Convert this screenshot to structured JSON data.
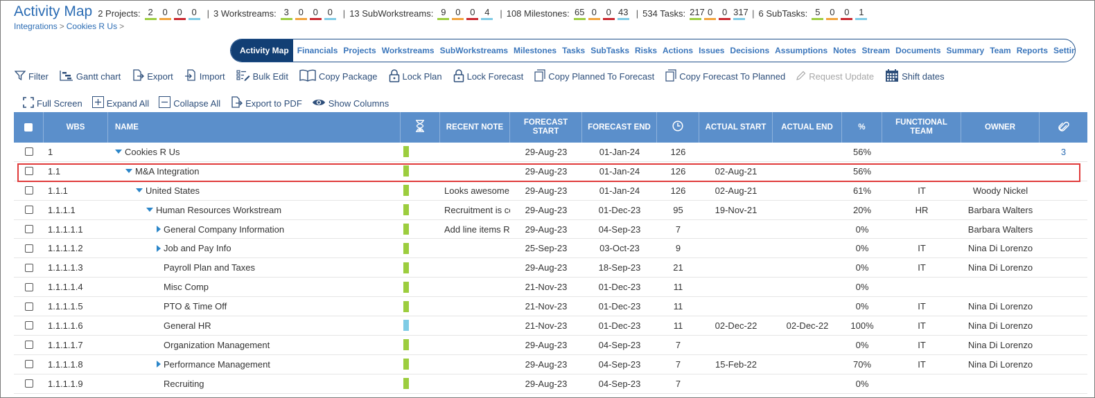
{
  "header": {
    "title": "Activity Map",
    "stats": [
      {
        "label": "2 Projects:",
        "values": [
          "2",
          "0",
          "0",
          "0"
        ]
      },
      {
        "label": "3 Workstreams:",
        "values": [
          "3",
          "0",
          "0",
          "0"
        ]
      },
      {
        "label": "13 SubWorkstreams:",
        "values": [
          "9",
          "0",
          "0",
          "4"
        ]
      },
      {
        "label": "108 Milestones:",
        "values": [
          "65",
          "0",
          "0",
          "43"
        ]
      },
      {
        "label": "534 Tasks:",
        "values": [
          "217",
          "0",
          "0",
          "317"
        ]
      },
      {
        "label": "6 SubTasks:",
        "values": [
          "5",
          "0",
          "0",
          "1"
        ]
      }
    ],
    "stat_separator": "|",
    "status_colors": [
      "#9ccd3e",
      "#f2a33a",
      "#c9252c",
      "#7ecbe5"
    ]
  },
  "breadcrumb": {
    "items": [
      "Integrations",
      "Cookies R Us"
    ],
    "separator": ">"
  },
  "nav": {
    "items": [
      "Activity Map",
      "Financials",
      "Projects",
      "Workstreams",
      "SubWorkstreams",
      "Milestones",
      "Tasks",
      "SubTasks",
      "Risks",
      "Actions",
      "Issues",
      "Decisions",
      "Assumptions",
      "Notes",
      "Stream",
      "Documents",
      "Summary",
      "Team",
      "Reports",
      "Settings"
    ],
    "active": "Activity Map"
  },
  "toolbar": {
    "filter": "Filter",
    "gantt": "Gantt chart",
    "export": "Export",
    "import": "Import",
    "bulk_edit": "Bulk Edit",
    "copy_package": "Copy Package",
    "lock_plan": "Lock Plan",
    "lock_forecast": "Lock Forecast",
    "copy_planned_to_forecast": "Copy Planned To Forecast",
    "copy_forecast_to_planned": "Copy Forecast To Planned",
    "request_update": "Request Update",
    "shift_dates": "Shift dates"
  },
  "toolbar2": {
    "full_screen": "Full Screen",
    "expand_all": "Expand All",
    "collapse_all": "Collapse All",
    "export_pdf": "Export to PDF",
    "show_columns": "Show Columns"
  },
  "table": {
    "columns": {
      "wbs": "WBS",
      "name": "NAME",
      "recent_note": "RECENT NOTE",
      "forecast_start": "FORECAST START",
      "forecast_end": "FORECAST END",
      "actual_start": "ACTUAL START",
      "actual_end": "ACTUAL END",
      "pct": "%",
      "functional_team": "FUNCTIONAL TEAM",
      "owner": "OWNER"
    },
    "rows": [
      {
        "wbs": "1",
        "name": "Cookies R Us",
        "indent": 0,
        "toggle": "down",
        "status": "#9ccd3e",
        "note": "",
        "fs": "29-Aug-23",
        "fe": "01-Jan-24",
        "dur": "126",
        "as": "",
        "ae": "",
        "pct": "56%",
        "team": "",
        "owner": "",
        "attach": "3"
      },
      {
        "wbs": "1.1",
        "name": "M&A Integration",
        "indent": 1,
        "toggle": "down",
        "status": "#9ccd3e",
        "note": "",
        "fs": "29-Aug-23",
        "fe": "01-Jan-24",
        "dur": "126",
        "as": "02-Aug-21",
        "ae": "",
        "pct": "56%",
        "team": "",
        "owner": "",
        "attach": ""
      },
      {
        "wbs": "1.1.1",
        "name": "United States",
        "indent": 2,
        "toggle": "down",
        "status": "#9ccd3e",
        "note": "Looks awesome",
        "fs": "29-Aug-23",
        "fe": "01-Jan-24",
        "dur": "126",
        "as": "02-Aug-21",
        "ae": "",
        "pct": "61%",
        "team": "IT",
        "owner": "Woody Nickel",
        "attach": ""
      },
      {
        "wbs": "1.1.1.1",
        "name": "Human Resources Workstream",
        "indent": 3,
        "toggle": "down",
        "status": "#9ccd3e",
        "note": "Recruitment is co",
        "fs": "29-Aug-23",
        "fe": "01-Dec-23",
        "dur": "95",
        "as": "19-Nov-21",
        "ae": "",
        "pct": "20%",
        "team": "HR",
        "owner": "Barbara Walters",
        "attach": ""
      },
      {
        "wbs": "1.1.1.1.1",
        "name": "General Company Information",
        "indent": 4,
        "toggle": "right",
        "status": "#9ccd3e",
        "note": "Add line items R",
        "fs": "29-Aug-23",
        "fe": "04-Sep-23",
        "dur": "7",
        "as": "",
        "ae": "",
        "pct": "0%",
        "team": "",
        "owner": "Barbara Walters",
        "attach": ""
      },
      {
        "wbs": "1.1.1.1.2",
        "name": "Job and Pay Info",
        "indent": 4,
        "toggle": "right",
        "status": "#9ccd3e",
        "note": "",
        "fs": "25-Sep-23",
        "fe": "03-Oct-23",
        "dur": "9",
        "as": "",
        "ae": "",
        "pct": "0%",
        "team": "IT",
        "owner": "Nina Di Lorenzo",
        "attach": ""
      },
      {
        "wbs": "1.1.1.1.3",
        "name": "Payroll Plan and Taxes",
        "indent": 4,
        "toggle": "none",
        "status": "#9ccd3e",
        "note": "",
        "fs": "29-Aug-23",
        "fe": "18-Sep-23",
        "dur": "21",
        "as": "",
        "ae": "",
        "pct": "0%",
        "team": "IT",
        "owner": "Nina Di Lorenzo",
        "attach": ""
      },
      {
        "wbs": "1.1.1.1.4",
        "name": "Misc Comp",
        "indent": 4,
        "toggle": "none",
        "status": "#9ccd3e",
        "note": "",
        "fs": "21-Nov-23",
        "fe": "01-Dec-23",
        "dur": "11",
        "as": "",
        "ae": "",
        "pct": "0%",
        "team": "",
        "owner": "",
        "attach": ""
      },
      {
        "wbs": "1.1.1.1.5",
        "name": "PTO & Time Off",
        "indent": 4,
        "toggle": "none",
        "status": "#9ccd3e",
        "note": "",
        "fs": "21-Nov-23",
        "fe": "01-Dec-23",
        "dur": "11",
        "as": "",
        "ae": "",
        "pct": "0%",
        "team": "IT",
        "owner": "Nina Di Lorenzo",
        "attach": ""
      },
      {
        "wbs": "1.1.1.1.6",
        "name": "General HR",
        "indent": 4,
        "toggle": "none",
        "status": "#7ecbe5",
        "note": "",
        "fs": "21-Nov-23",
        "fe": "01-Dec-23",
        "dur": "11",
        "as": "02-Dec-22",
        "ae": "02-Dec-22",
        "pct": "100%",
        "team": "IT",
        "owner": "Nina Di Lorenzo",
        "attach": ""
      },
      {
        "wbs": "1.1.1.1.7",
        "name": "Organization Management",
        "indent": 4,
        "toggle": "none",
        "status": "#9ccd3e",
        "note": "",
        "fs": "29-Aug-23",
        "fe": "04-Sep-23",
        "dur": "7",
        "as": "",
        "ae": "",
        "pct": "0%",
        "team": "IT",
        "owner": "Nina Di Lorenzo",
        "attach": ""
      },
      {
        "wbs": "1.1.1.1.8",
        "name": "Performance Management",
        "indent": 4,
        "toggle": "right",
        "status": "#9ccd3e",
        "note": "",
        "fs": "29-Aug-23",
        "fe": "04-Sep-23",
        "dur": "7",
        "as": "15-Feb-22",
        "ae": "",
        "pct": "70%",
        "team": "IT",
        "owner": "Nina Di Lorenzo",
        "attach": ""
      },
      {
        "wbs": "1.1.1.1.9",
        "name": "Recruiting",
        "indent": 4,
        "toggle": "none",
        "status": "#9ccd3e",
        "note": "",
        "fs": "29-Aug-23",
        "fe": "04-Sep-23",
        "dur": "7",
        "as": "",
        "ae": "",
        "pct": "0%",
        "team": "",
        "owner": "",
        "attach": ""
      }
    ]
  }
}
